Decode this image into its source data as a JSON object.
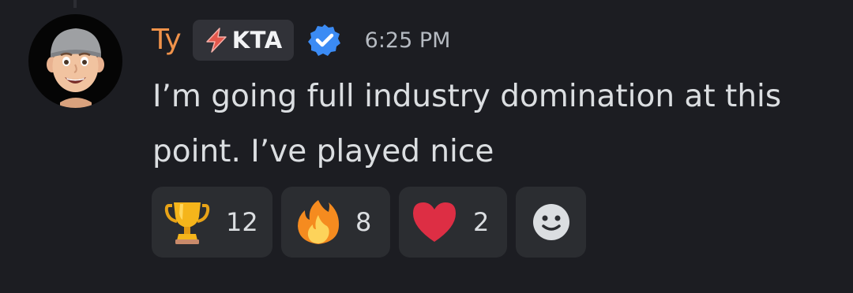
{
  "message": {
    "author": "Ty",
    "tag": "KTA",
    "timestamp": "6:25 PM",
    "text": "I’m going full industry domination at this point. I’ve played nice",
    "icons": {
      "avatar": "memoji-avatar-icon",
      "tag": "lightning-bolt-icon",
      "verified": "verified-check-icon"
    }
  },
  "reactions": [
    {
      "icon": "trophy-icon",
      "count": "12"
    },
    {
      "icon": "fire-icon",
      "count": "8"
    },
    {
      "icon": "heart-icon",
      "count": "2"
    }
  ],
  "add_reaction": {
    "icon": "add-reaction-smiley-icon"
  },
  "colors": {
    "background": "#1c1d22",
    "username": "#f0924a",
    "text": "#dbdee1",
    "timestamp": "#b5bac1",
    "reaction_bg": "#2b2d31",
    "verified": "#3b8bf4"
  }
}
